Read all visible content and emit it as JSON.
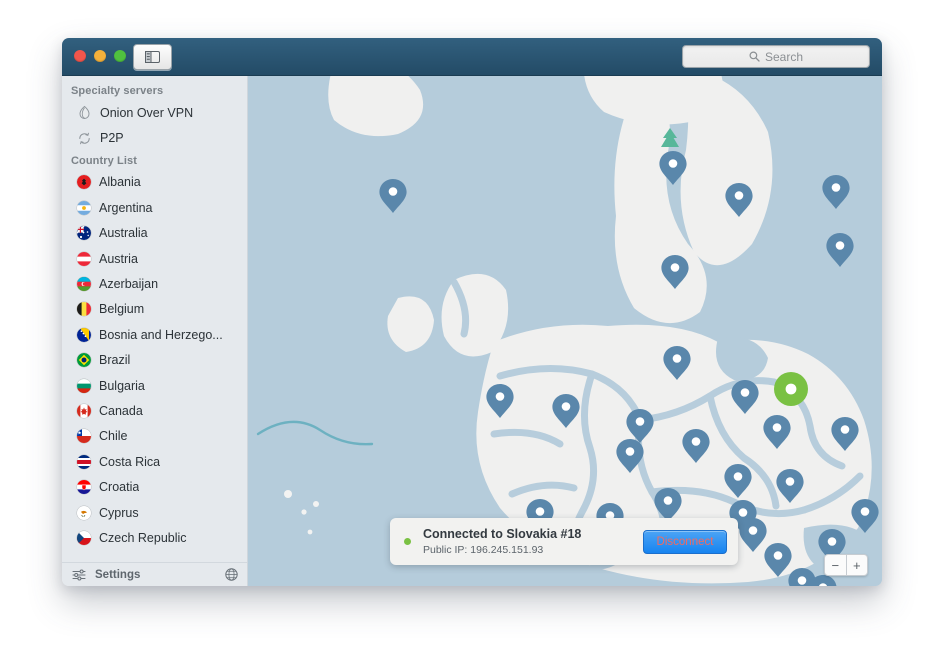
{
  "window": {
    "traffic_lights": [
      "close",
      "minimize",
      "zoom"
    ],
    "sidebar_toggle_icon": "sidebar-toggle-icon"
  },
  "search": {
    "placeholder": "Search",
    "value": "",
    "icon": "search-icon"
  },
  "sidebar": {
    "specialty_title": "Specialty servers",
    "specialty": [
      {
        "label": "Onion Over VPN",
        "icon": "onion-icon"
      },
      {
        "label": "P2P",
        "icon": "p2p-icon"
      }
    ],
    "country_title": "Country List",
    "countries": [
      {
        "label": "Albania",
        "flag": "albania-flag-icon"
      },
      {
        "label": "Argentina",
        "flag": "argentina-flag-icon"
      },
      {
        "label": "Australia",
        "flag": "australia-flag-icon"
      },
      {
        "label": "Austria",
        "flag": "austria-flag-icon"
      },
      {
        "label": "Azerbaijan",
        "flag": "azerbaijan-flag-icon"
      },
      {
        "label": "Belgium",
        "flag": "belgium-flag-icon"
      },
      {
        "label": "Bosnia and Herzego...",
        "flag": "bosnia-flag-icon"
      },
      {
        "label": "Brazil",
        "flag": "brazil-flag-icon"
      },
      {
        "label": "Bulgaria",
        "flag": "bulgaria-flag-icon"
      },
      {
        "label": "Canada",
        "flag": "canada-flag-icon"
      },
      {
        "label": "Chile",
        "flag": "chile-flag-icon"
      },
      {
        "label": "Costa Rica",
        "flag": "costarica-flag-icon"
      },
      {
        "label": "Croatia",
        "flag": "croatia-flag-icon"
      },
      {
        "label": "Cyprus",
        "flag": "cyprus-flag-icon"
      },
      {
        "label": "Czech Republic",
        "flag": "czech-flag-icon"
      }
    ],
    "settings_label": "Settings",
    "settings_icon": "sliders-icon",
    "globe_icon": "globe-icon"
  },
  "status_popup": {
    "title": "Connected to Slovakia #18",
    "public_ip": "Public IP: 196.245.151.93",
    "button_label": "Disconnect",
    "status_color": "#7ac143"
  },
  "map": {
    "zoom_in_label": "+",
    "zoom_out_label": "−",
    "water_color": "#b5ccdb",
    "land_color": "#f0f0ef",
    "pin_color": "#5a87ab",
    "active_pin_color": "#7ac143",
    "tree_color": "#57b79a"
  }
}
